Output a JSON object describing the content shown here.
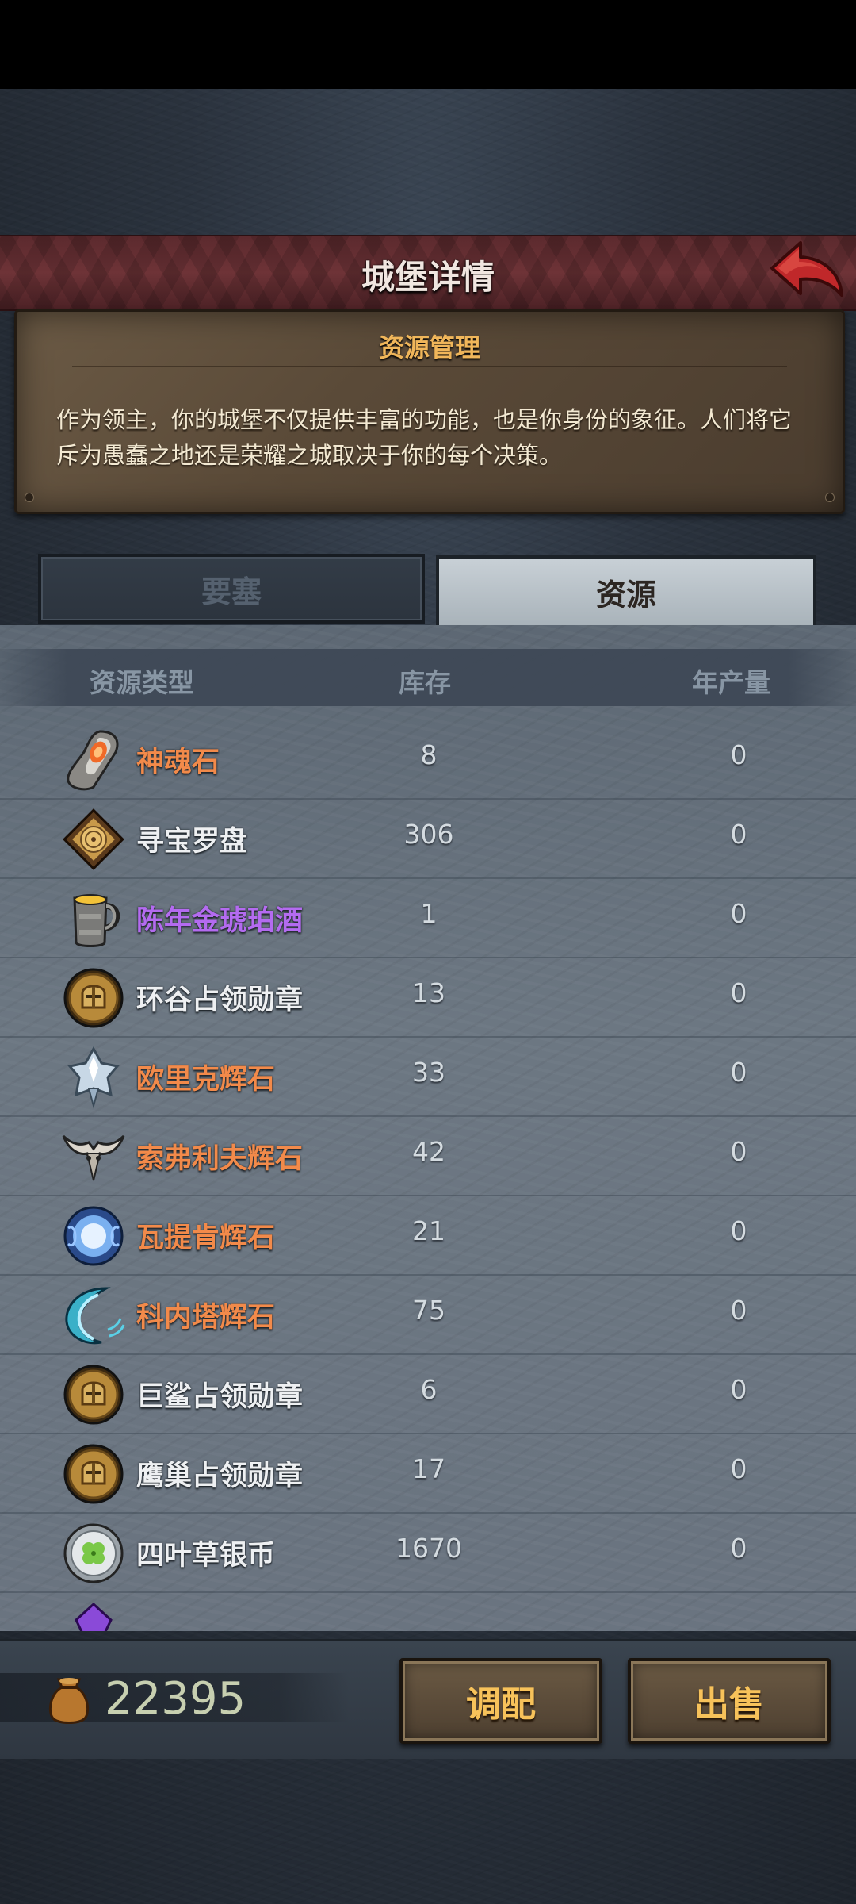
{
  "header": {
    "title": "城堡详情"
  },
  "intro": {
    "title": "资源管理",
    "body": "作为领主，你的城堡不仅提供丰富的功能，也是你身份的象征。人们将它斥为愚蠢之地还是荣耀之城取决于你的每个决策。"
  },
  "tabs": [
    {
      "label": "要塞",
      "active": false
    },
    {
      "label": "资源",
      "active": true
    }
  ],
  "columns": {
    "type": "资源类型",
    "stock": "库存",
    "yield": "年产量"
  },
  "resources": [
    {
      "name": "神魂石",
      "stock": "8",
      "yield": "0",
      "color": "#f28a4a",
      "icon": "soul-stone-icon"
    },
    {
      "name": "寻宝罗盘",
      "stock": "306",
      "yield": "0",
      "color": "#eef0f2",
      "icon": "treasure-compass-icon"
    },
    {
      "name": "陈年金琥珀酒",
      "stock": "1",
      "yield": "0",
      "color": "#b46bf0",
      "icon": "amber-ale-icon"
    },
    {
      "name": "环谷占领勋章",
      "stock": "13",
      "yield": "0",
      "color": "#eef0f2",
      "icon": "medal-icon"
    },
    {
      "name": "欧里克辉石",
      "stock": "33",
      "yield": "0",
      "color": "#f28a4a",
      "icon": "crystal-icon"
    },
    {
      "name": "索弗利夫辉石",
      "stock": "42",
      "yield": "0",
      "color": "#f28a4a",
      "icon": "horned-skull-icon"
    },
    {
      "name": "瓦提肯辉石",
      "stock": "21",
      "yield": "0",
      "color": "#f28a4a",
      "icon": "blue-orb-icon"
    },
    {
      "name": "科内塔辉石",
      "stock": "75",
      "yield": "0",
      "color": "#f28a4a",
      "icon": "crescent-icon"
    },
    {
      "name": "巨鲨占领勋章",
      "stock": "6",
      "yield": "0",
      "color": "#eef0f2",
      "icon": "medal-icon"
    },
    {
      "name": "鹰巢占领勋章",
      "stock": "17",
      "yield": "0",
      "color": "#eef0f2",
      "icon": "medal-icon"
    },
    {
      "name": "四叶草银币",
      "stock": "1670",
      "yield": "0",
      "color": "#eef0f2",
      "icon": "clover-coin-icon"
    }
  ],
  "footer": {
    "gold": "22395",
    "allocate_label": "调配",
    "sell_label": "出售"
  }
}
